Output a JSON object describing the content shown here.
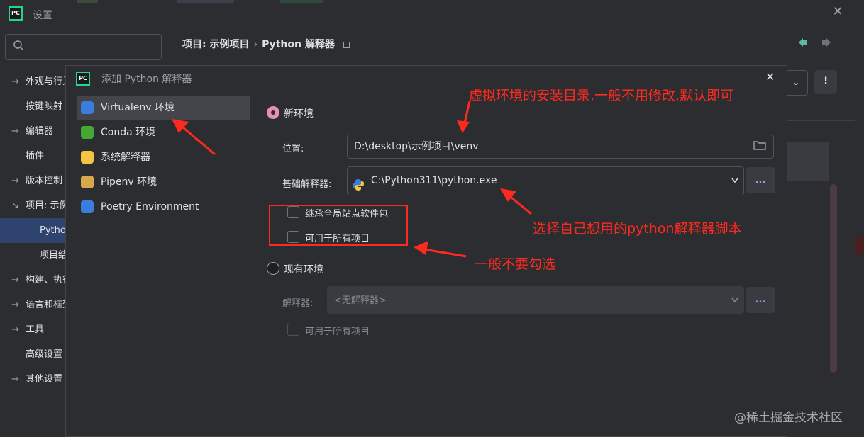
{
  "window": {
    "logo": "PC",
    "title": "设置",
    "close_glyph": "✕"
  },
  "breadcrumb": {
    "project": "项目: 示例项目",
    "separator": "›",
    "current": "Python 解释器"
  },
  "sidebar": {
    "items": [
      {
        "label": "外观与行为",
        "arrow": "→"
      },
      {
        "label": "按键映射",
        "arrow": ""
      },
      {
        "label": "编辑器",
        "arrow": "→"
      },
      {
        "label": "插件",
        "arrow": ""
      },
      {
        "label": "版本控制",
        "arrow": "→"
      },
      {
        "label": "项目: 示例项目",
        "arrow": "↘"
      },
      {
        "label": "Python 解释器",
        "arrow": ""
      },
      {
        "label": "项目结构",
        "arrow": ""
      },
      {
        "label": "构建、执行、部署",
        "arrow": "→"
      },
      {
        "label": "语言和框架",
        "arrow": "→"
      },
      {
        "label": "工具",
        "arrow": "→"
      },
      {
        "label": "高级设置",
        "arrow": ""
      },
      {
        "label": "其他设置",
        "arrow": "→"
      }
    ]
  },
  "dialog": {
    "logo": "PC",
    "title": "添加 Python 解释器",
    "close_glyph": "✕",
    "env_types": [
      {
        "label": "Virtualenv 环境",
        "icon": "python-icon",
        "color": "#3b7ddd"
      },
      {
        "label": "Conda 环境",
        "icon": "conda-icon",
        "color": "#44a833"
      },
      {
        "label": "系统解释器",
        "icon": "python-icon",
        "color": "#f4c542"
      },
      {
        "label": "Pipenv 环境",
        "icon": "folder-icon",
        "color": "#d8a84a"
      },
      {
        "label": "Poetry Environment",
        "icon": "poetry-icon",
        "color": "#3b7ddd"
      }
    ],
    "new_env": {
      "radio_label": "新环境",
      "location_label": "位置:",
      "location_value": "D:\\desktop\\示例项目\\venv",
      "base_label": "基础解释器:",
      "base_value": "C:\\Python311\\python.exe",
      "inherit_label": "继承全局站点软件包",
      "all_projects_label": "可用于所有项目",
      "dots": "..."
    },
    "existing_env": {
      "radio_label": "现有环境",
      "interp_label": "解释器:",
      "interp_value": "<无解释器>",
      "all_projects_label": "可用于所有项目",
      "dots": "..."
    }
  },
  "right_panel": {
    "more_glyph": "⋮",
    "chevron": "⌄"
  },
  "annotations": {
    "location_note": "虚拟环境的安装目录,一般不用修改,默认即可",
    "interpreter_note": "选择自己想用的python解释器脚本",
    "checkbox_note": "一般不要勾选"
  },
  "colors": {
    "accent": "#e88dbb",
    "annotation": "#ff2a1f",
    "selection": "#2e436e"
  },
  "watermark": "@稀土掘金技术社区"
}
